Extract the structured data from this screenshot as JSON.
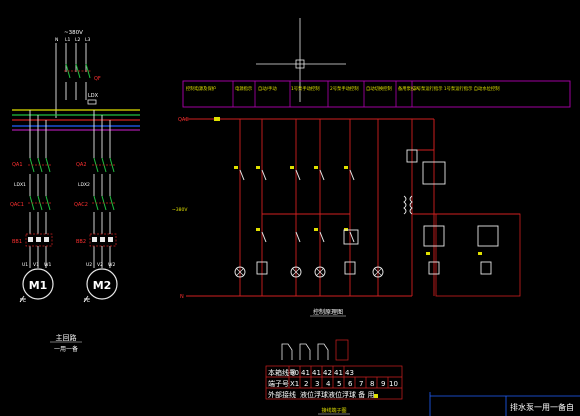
{
  "colors": {
    "background": "#000000",
    "wire_white": "#e8e8e8",
    "wire_red": "#d02020",
    "wire_green": "#20c040",
    "wire_yellow": "#e0e000",
    "wire_blue": "#2060ff",
    "header_magenta": "#b000b0",
    "label_yellow": "#e0e000",
    "label_green": "#20d040",
    "label_red": "#ff3030",
    "text_white": "#ffffff"
  },
  "main_circuit": {
    "voltage": "~380V",
    "phase_labels": [
      "N",
      "L1",
      "L2",
      "L3"
    ],
    "qf": "QF",
    "ldx": "LDX",
    "qa1": "QA1",
    "qa2": "QA2",
    "ldx1": "LDX1",
    "ldx2": "LDX2",
    "qac1": "QAC1",
    "qac2": "QAC2",
    "bb1": "BB1",
    "bb2": "BB2",
    "terms_m1": [
      "U1",
      "V1",
      "W1"
    ],
    "terms_m2": [
      "U2",
      "V2",
      "W2"
    ],
    "pe": "PE",
    "motor1": "M1",
    "motor2": "M2",
    "caption": "主回路",
    "caption_sub": "一用一备"
  },
  "control_circuit": {
    "header_cells": [
      "控制电源及保护",
      "电源指示",
      "自动/手动",
      "1号泵手动控制",
      "2号泵手动控制",
      "自动切换控制",
      "备用泵投入",
      "2号泵运行指示 1号泵运行指示 自动水位控制"
    ],
    "left_label_top": "QAC",
    "left_label_bottom": "N",
    "voltage_tag": "~380V",
    "caption": "控制原理图"
  },
  "terminal_table": {
    "row1_label": "本箱线号",
    "row1_values": [
      "30",
      "41",
      "41",
      "42",
      "41",
      "43"
    ],
    "row2_label": "端子号",
    "row2_values": [
      "X1",
      "2",
      "3",
      "4",
      "5",
      "6",
      "7",
      "8",
      "9",
      "10"
    ],
    "row3_label": "外部接线",
    "row3_text": "液位浮球液位浮球 备 用",
    "caption": "接线端子图"
  },
  "title_block": {
    "drawing_title": "排水泵一用一备自"
  }
}
